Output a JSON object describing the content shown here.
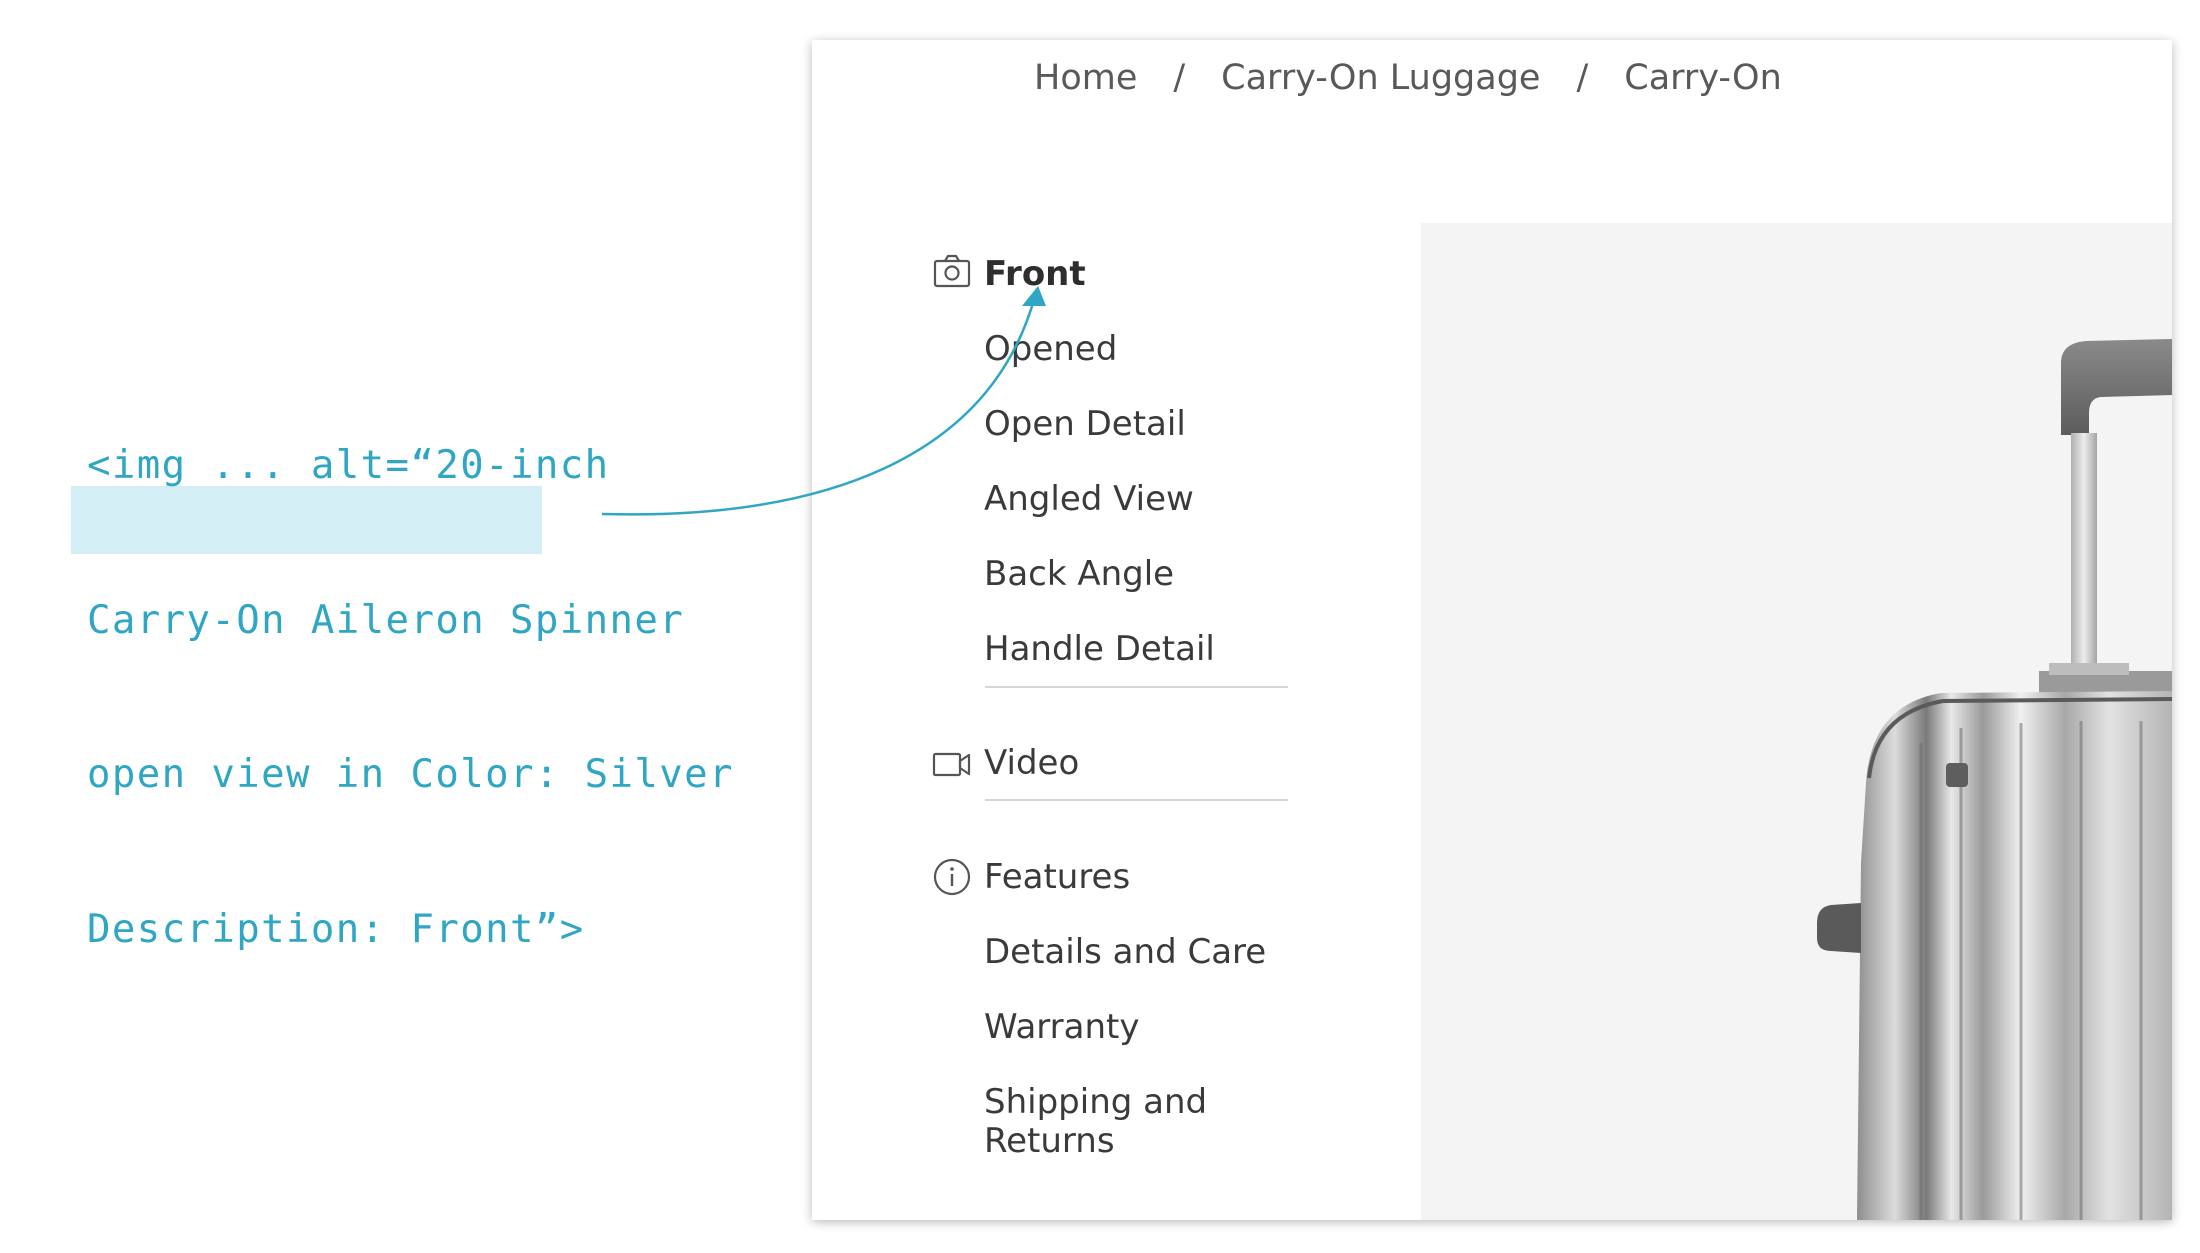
{
  "annotation": {
    "lines": [
      "<img ... alt=“20-inch",
      "Carry-On Aileron Spinner",
      "open view in Color: Silver",
      "Description: Front”>"
    ],
    "color": "#2fa6c4",
    "highlight_color": "#d3eef5"
  },
  "breadcrumb": {
    "items": [
      "Home",
      "Carry-On Luggage",
      "Carry-On"
    ],
    "separator": "/"
  },
  "nav": {
    "media_group": {
      "icon": "camera-icon",
      "items": [
        "Front",
        "Opened",
        "Open Detail",
        "Angled View",
        "Back Angle",
        "Handle Detail"
      ],
      "active": "Front"
    },
    "video_group": {
      "icon": "video-camera-icon",
      "label": "Video"
    },
    "info_group": {
      "icon": "info-icon",
      "items": [
        "Features",
        "Details and Care",
        "Warranty",
        "Shipping and",
        "Returns"
      ]
    }
  },
  "product_image": {
    "description": "silver-carry-on-suitcase"
  }
}
